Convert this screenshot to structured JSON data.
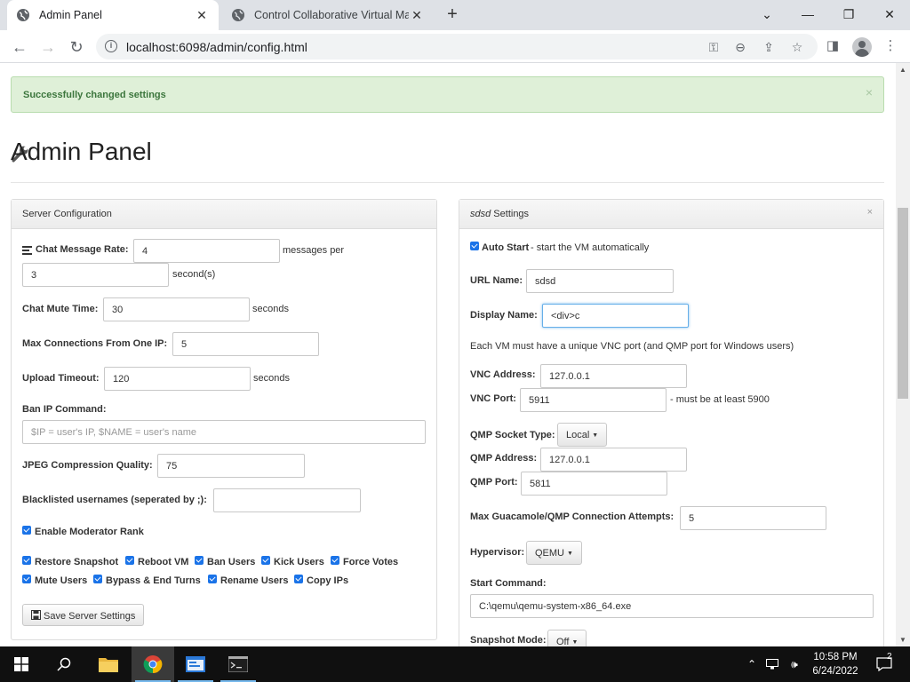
{
  "browser": {
    "tabs": [
      {
        "title": "Admin Panel",
        "active": true
      },
      {
        "title": "Control Collaborative Virtual Mac",
        "active": false
      }
    ],
    "new_tab": "+",
    "url": "localhost:6098/admin/config.html",
    "window_controls": {
      "minimize": "—",
      "restore": "❐",
      "close": "✕",
      "tab_search": "⌄"
    }
  },
  "alert": {
    "message": "Successfully changed settings",
    "close": "×"
  },
  "page": {
    "title": "Admin Panel"
  },
  "server_config": {
    "header": "Server Configuration",
    "chat_message_rate": {
      "label": "Chat Message Rate:",
      "value": "4",
      "suffix": "messages per"
    },
    "chat_rate_seconds": {
      "value": "3",
      "suffix": "second(s)"
    },
    "chat_mute_time": {
      "label": "Chat Mute Time:",
      "value": "30",
      "suffix": "seconds"
    },
    "max_connections": {
      "label": "Max Connections From One IP:",
      "value": "5"
    },
    "upload_timeout": {
      "label": "Upload Timeout:",
      "value": "120",
      "suffix": "seconds"
    },
    "ban_ip_command": {
      "label": "Ban IP Command:",
      "placeholder": "$IP = user's IP, $NAME = user's name"
    },
    "jpeg_quality": {
      "label": "JPEG Compression Quality:",
      "value": "75"
    },
    "blacklisted_usernames": {
      "label": "Blacklisted usernames (seperated by ;):",
      "value": ""
    },
    "enable_moderator_rank": {
      "label": "Enable Moderator Rank",
      "checked": true
    },
    "permissions_row1": [
      {
        "label": "Restore Snapshot",
        "checked": true
      },
      {
        "label": "Reboot VM",
        "checked": true
      },
      {
        "label": "Ban Users",
        "checked": true
      },
      {
        "label": "Kick Users",
        "checked": true
      },
      {
        "label": "Force Votes",
        "checked": true
      }
    ],
    "permissions_row2": [
      {
        "label": "Mute Users",
        "checked": true
      },
      {
        "label": "Bypass & End Turns",
        "checked": true
      },
      {
        "label": "Rename Users",
        "checked": true
      },
      {
        "label": "Copy IPs",
        "checked": true
      }
    ],
    "save_button": "Save Server Settings"
  },
  "vm_settings": {
    "header_name": "sdsd",
    "header_suffix": " Settings",
    "close": "×",
    "auto_start": {
      "label": "Auto Start",
      "desc": " - start the VM automatically",
      "checked": true
    },
    "url_name": {
      "label": "URL Name:",
      "value": "sdsd"
    },
    "display_name": {
      "label": "Display Name:",
      "value": "<div>c"
    },
    "vnc_note": "Each VM must have a unique VNC port (and QMP port for Windows users)",
    "vnc_address": {
      "label": "VNC Address:",
      "value": "127.0.0.1"
    },
    "vnc_port": {
      "label": "VNC Port:",
      "value": "5911",
      "note": "- must be at least 5900"
    },
    "qmp_socket_type": {
      "label": "QMP Socket Type:",
      "value": "Local"
    },
    "qmp_address": {
      "label": "QMP Address:",
      "value": "127.0.0.1"
    },
    "qmp_port": {
      "label": "QMP Port:",
      "value": "5811"
    },
    "max_attempts": {
      "label": "Max Guacamole/QMP Connection Attempts:",
      "value": "5"
    },
    "hypervisor": {
      "label": "Hypervisor:",
      "value": "QEMU"
    },
    "start_command": {
      "label": "Start Command:",
      "value": "C:\\qemu\\qemu-system-x86_64.exe"
    },
    "snapshot_mode": {
      "label": "Snapshot Mode:",
      "value": "Off"
    }
  },
  "taskbar": {
    "clock_time": "10:58 PM",
    "clock_date": "6/24/2022",
    "notifications": "2"
  },
  "colors": {
    "alert_bg": "#dff0d8",
    "alert_text": "#3c763d",
    "checkbox": "#1a73e8",
    "taskbar": "#101010"
  }
}
